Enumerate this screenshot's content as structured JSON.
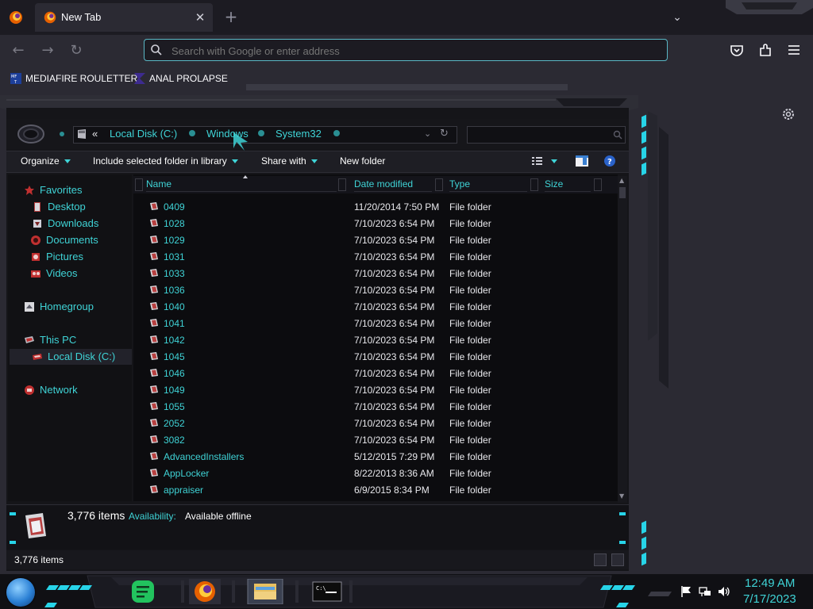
{
  "browser": {
    "tab_title": "New Tab",
    "url_placeholder": "Search with Google or enter address",
    "bookmarks": [
      {
        "label": "MEDIAFIRE ROULETTER",
        "icon": "mediafire-icon"
      },
      {
        "label": "ANAL PROLAPSE",
        "icon": "purple-chevron-icon"
      }
    ]
  },
  "explorer": {
    "breadcrumbs": [
      "Local Disk (C:)",
      "Windows",
      "System32"
    ],
    "breadcrumb_overflow": "«",
    "commands": [
      {
        "label": "Organize",
        "dropdown": true
      },
      {
        "label": "Include selected folder in library",
        "dropdown": true
      },
      {
        "label": "Share with",
        "dropdown": true
      },
      {
        "label": "New folder",
        "dropdown": false
      }
    ],
    "nav": {
      "favorites": "Favorites",
      "desktop": "Desktop",
      "downloads": "Downloads",
      "documents": "Documents",
      "pictures": "Pictures",
      "videos": "Videos",
      "homegroup": "Homegroup",
      "this_pc": "This PC",
      "local_disk": "Local Disk (C:)",
      "network": "Network"
    },
    "columns": {
      "name": "Name",
      "date_modified": "Date modified",
      "type": "Type",
      "size": "Size"
    },
    "rows": [
      {
        "name": "0409",
        "date": "11/20/2014 7:50 PM",
        "type": "File folder"
      },
      {
        "name": "1028",
        "date": "7/10/2023 6:54 PM",
        "type": "File folder"
      },
      {
        "name": "1029",
        "date": "7/10/2023 6:54 PM",
        "type": "File folder"
      },
      {
        "name": "1031",
        "date": "7/10/2023 6:54 PM",
        "type": "File folder"
      },
      {
        "name": "1033",
        "date": "7/10/2023 6:54 PM",
        "type": "File folder"
      },
      {
        "name": "1036",
        "date": "7/10/2023 6:54 PM",
        "type": "File folder"
      },
      {
        "name": "1040",
        "date": "7/10/2023 6:54 PM",
        "type": "File folder"
      },
      {
        "name": "1041",
        "date": "7/10/2023 6:54 PM",
        "type": "File folder"
      },
      {
        "name": "1042",
        "date": "7/10/2023 6:54 PM",
        "type": "File folder"
      },
      {
        "name": "1045",
        "date": "7/10/2023 6:54 PM",
        "type": "File folder"
      },
      {
        "name": "1046",
        "date": "7/10/2023 6:54 PM",
        "type": "File folder"
      },
      {
        "name": "1049",
        "date": "7/10/2023 6:54 PM",
        "type": "File folder"
      },
      {
        "name": "1055",
        "date": "7/10/2023 6:54 PM",
        "type": "File folder"
      },
      {
        "name": "2052",
        "date": "7/10/2023 6:54 PM",
        "type": "File folder"
      },
      {
        "name": "3082",
        "date": "7/10/2023 6:54 PM",
        "type": "File folder"
      },
      {
        "name": "AdvancedInstallers",
        "date": "5/12/2015 7:29 PM",
        "type": "File folder"
      },
      {
        "name": "AppLocker",
        "date": "8/22/2013 8:36 AM",
        "type": "File folder"
      },
      {
        "name": "appraiser",
        "date": "6/9/2015 8:34 PM",
        "type": "File folder"
      }
    ],
    "details": {
      "count": "3,776 items",
      "availability_label": "Availability:",
      "availability_value": "Available offline"
    },
    "status": "3,776 items"
  },
  "taskbar": {
    "time": "12:49 AM",
    "date": "7/17/2023"
  },
  "colors": {
    "accent": "#3fd3d6",
    "led": "#27d4e8",
    "window_bg": "#151519"
  }
}
